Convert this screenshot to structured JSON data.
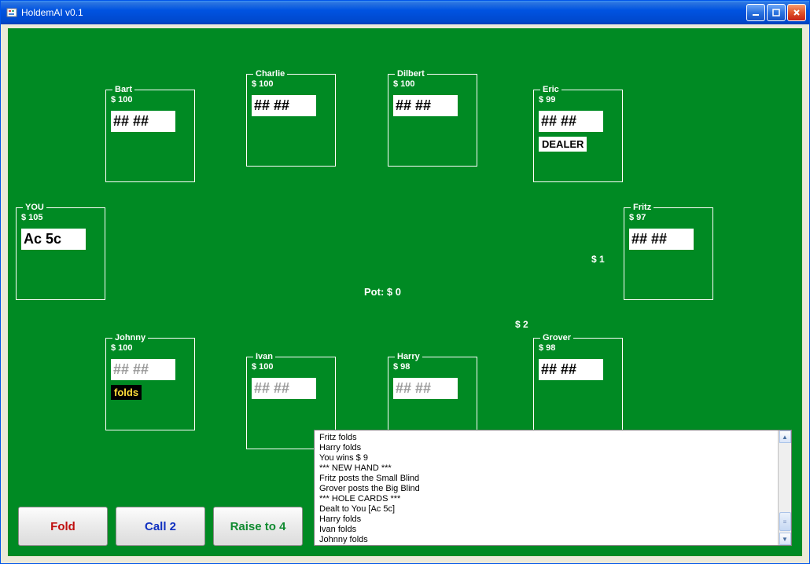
{
  "window": {
    "title": "HoldemAI v0.1"
  },
  "pot": "Pot: $ 0",
  "bets": {
    "fritz": "$ 1",
    "grover": "$ 2"
  },
  "players": {
    "you": {
      "name": "YOU",
      "stack": "$ 105",
      "cards": "Ac 5c",
      "hidden": false
    },
    "bart": {
      "name": "Bart",
      "stack": "$ 100",
      "cards": "## ##",
      "hidden": false
    },
    "charlie": {
      "name": "Charlie",
      "stack": "$ 100",
      "cards": "## ##",
      "hidden": false
    },
    "dilbert": {
      "name": "Dilbert",
      "stack": "$ 100",
      "cards": "## ##",
      "hidden": false
    },
    "eric": {
      "name": "Eric",
      "stack": "$ 99",
      "cards": "## ##",
      "hidden": false,
      "dealer": "DEALER"
    },
    "fritz": {
      "name": "Fritz",
      "stack": "$ 97",
      "cards": "## ##",
      "hidden": false
    },
    "grover": {
      "name": "Grover",
      "stack": "$ 98",
      "cards": "## ##",
      "hidden": false
    },
    "harry": {
      "name": "Harry",
      "stack": "$ 98",
      "cards": "## ##",
      "hidden": true
    },
    "ivan": {
      "name": "Ivan",
      "stack": "$ 100",
      "cards": "## ##",
      "hidden": true
    },
    "johnny": {
      "name": "Johnny",
      "stack": "$ 100",
      "cards": "## ##",
      "hidden": true,
      "status": "folds"
    }
  },
  "actions": {
    "fold": "Fold",
    "call": "Call 2",
    "raise": "Raise to 4"
  },
  "log": "Fritz folds\nHarry folds\nYou wins $ 9\n*** NEW HAND ***\nFritz posts the Small Blind\nGrover posts the Big Blind\n*** HOLE CARDS ***\nDealt to You [Ac 5c]\nHarry folds\nIvan folds\nJohnny folds"
}
